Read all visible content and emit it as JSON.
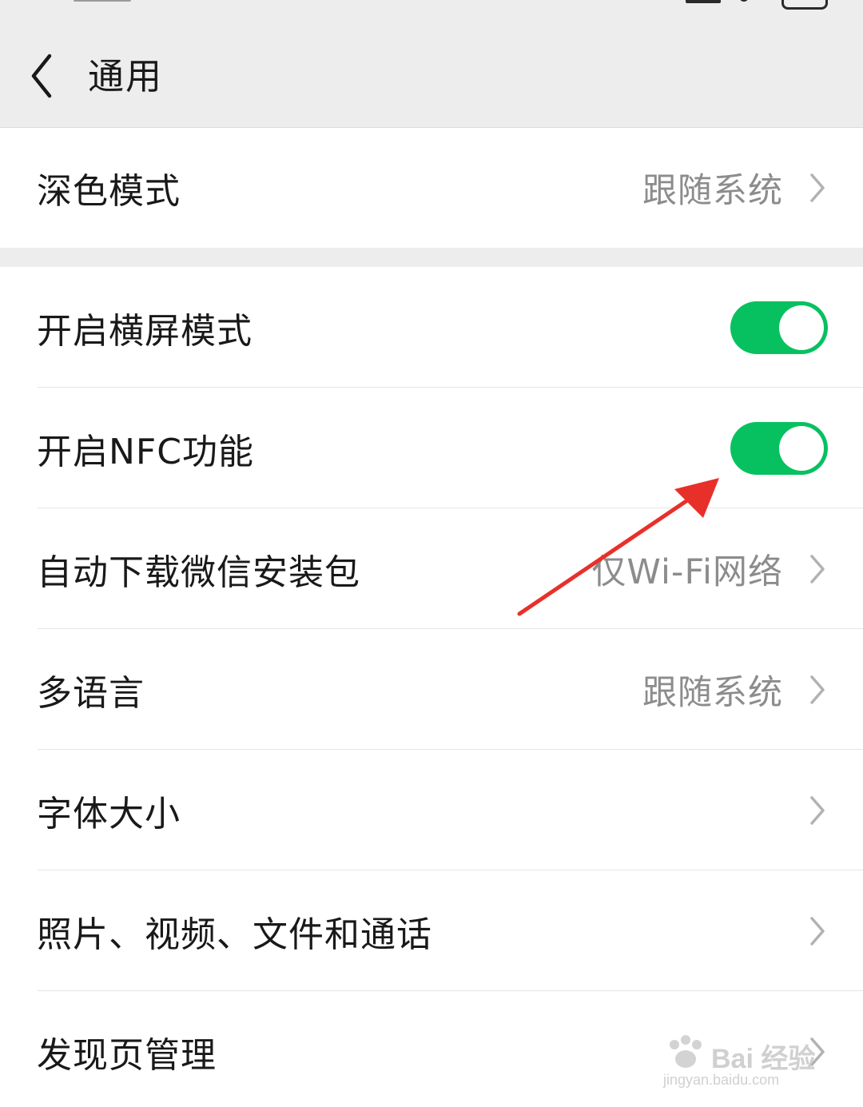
{
  "header": {
    "title": "通用"
  },
  "section1": {
    "rows": [
      {
        "label": "深色模式",
        "value": "跟随系统"
      }
    ]
  },
  "section2": {
    "rows": [
      {
        "label": "开启横屏模式",
        "toggle": "on"
      },
      {
        "label": "开启NFC功能",
        "toggle": "on"
      },
      {
        "label": "自动下载微信安装包",
        "value": "仅Wi-Fi网络"
      },
      {
        "label": "多语言",
        "value": "跟随系统"
      },
      {
        "label": "字体大小"
      },
      {
        "label": "照片、视频、文件和通话"
      },
      {
        "label": "发现页管理"
      }
    ]
  },
  "colors": {
    "toggle_on": "#07c160",
    "annotation_arrow": "#e8302a"
  },
  "watermark": {
    "text": "Bai 经验",
    "sub": "jingyan.baidu.com"
  }
}
